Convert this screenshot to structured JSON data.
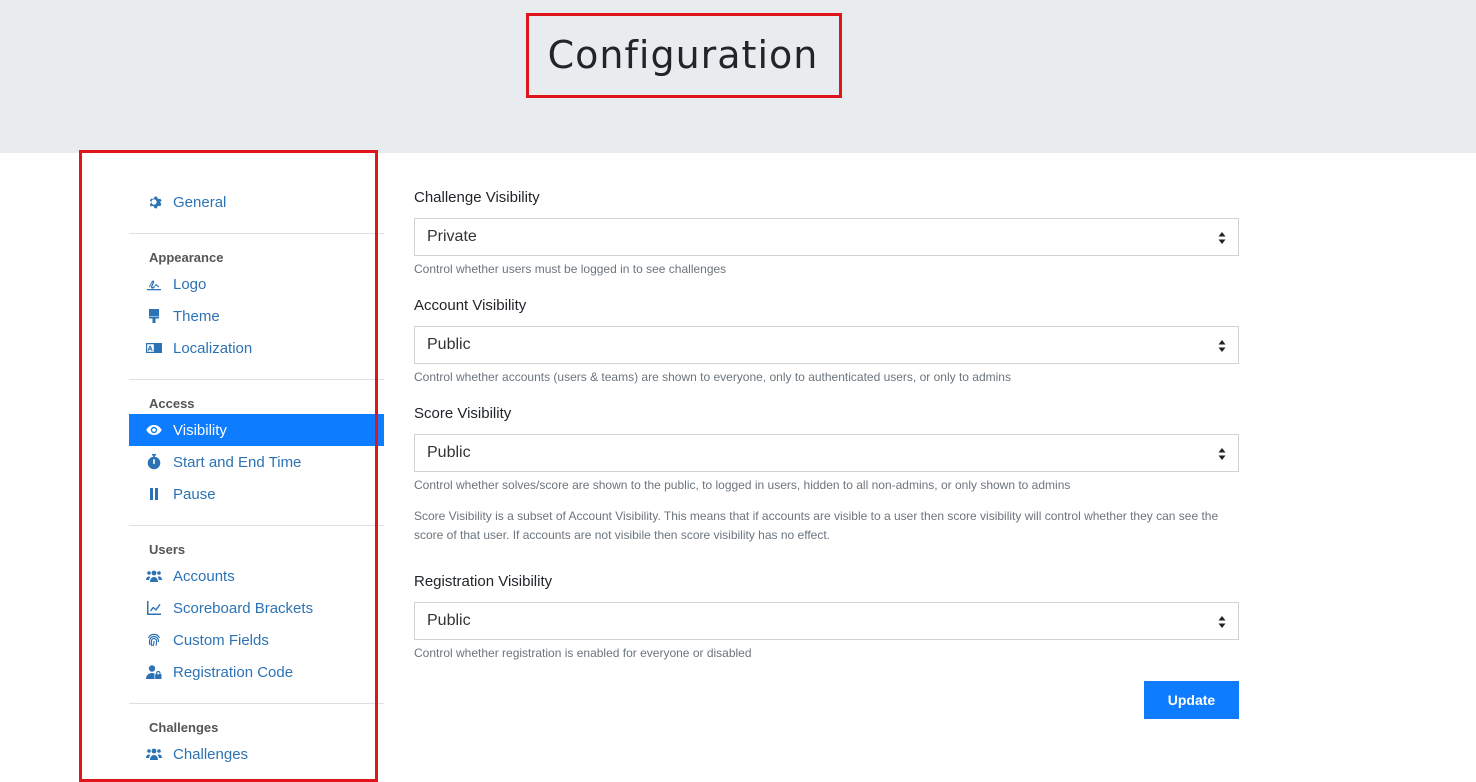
{
  "page": {
    "title": "Configuration"
  },
  "colors": {
    "accent": "#0d7cff",
    "link": "#2c73b5",
    "highlight": "#e0151c",
    "header_bg": "#e9ecef"
  },
  "sidebar": {
    "general": {
      "label": "General",
      "icon": "gear-icon"
    },
    "sections": [
      {
        "heading": "Appearance",
        "items": [
          {
            "label": "Logo",
            "icon": "signature-icon"
          },
          {
            "label": "Theme",
            "icon": "paint-brush-icon"
          },
          {
            "label": "Localization",
            "icon": "language-icon"
          }
        ]
      },
      {
        "heading": "Access",
        "items": [
          {
            "label": "Visibility",
            "icon": "eye-icon",
            "active": true
          },
          {
            "label": "Start and End Time",
            "icon": "stopwatch-icon"
          },
          {
            "label": "Pause",
            "icon": "pause-icon"
          }
        ]
      },
      {
        "heading": "Users",
        "items": [
          {
            "label": "Accounts",
            "icon": "users-icon"
          },
          {
            "label": "Scoreboard Brackets",
            "icon": "chart-line-icon"
          },
          {
            "label": "Custom Fields",
            "icon": "fingerprint-icon"
          },
          {
            "label": "Registration Code",
            "icon": "user-lock-icon"
          }
        ]
      },
      {
        "heading": "Challenges",
        "items": [
          {
            "label": "Challenges",
            "icon": "users-icon"
          }
        ]
      }
    ]
  },
  "form": {
    "challenge_visibility": {
      "label": "Challenge Visibility",
      "value": "Private",
      "help": "Control whether users must be logged in to see challenges"
    },
    "account_visibility": {
      "label": "Account Visibility",
      "value": "Public",
      "help": "Control whether accounts (users & teams) are shown to everyone, only to authenticated users, or only to admins"
    },
    "score_visibility": {
      "label": "Score Visibility",
      "value": "Public",
      "help": "Control whether solves/score are shown to the public, to logged in users, hidden to all non-admins, or only shown to admins",
      "note": "Score Visibility is a subset of Account Visibility. This means that if accounts are visible to a user then score visibility will control whether they can see the score of that user. If accounts are not visibile then score visibility has no effect."
    },
    "registration_visibility": {
      "label": "Registration Visibility",
      "value": "Public",
      "help": "Control whether registration is enabled for everyone or disabled"
    },
    "update_label": "Update"
  }
}
